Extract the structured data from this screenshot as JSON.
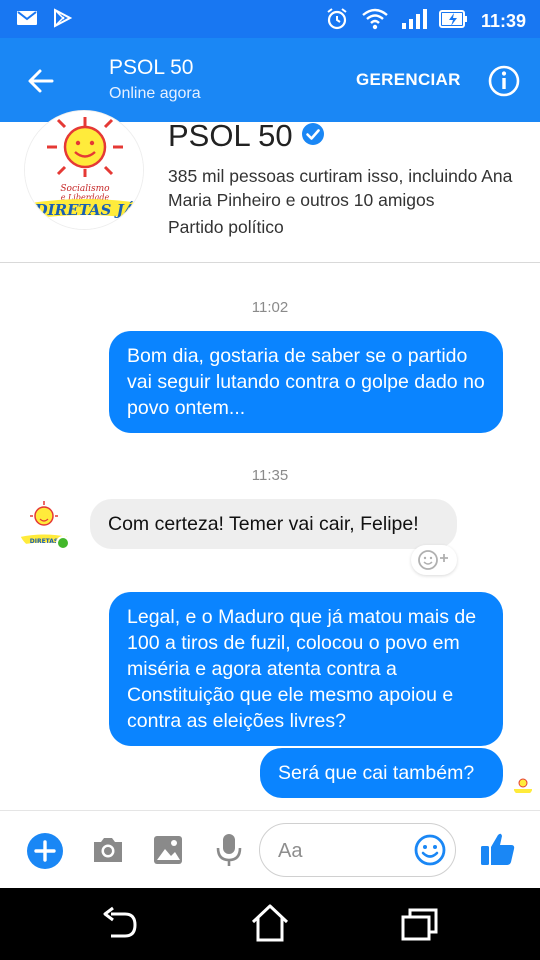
{
  "status_bar": {
    "time": "11:39",
    "icons": [
      "mail-icon",
      "play-store-icon",
      "alarm-icon",
      "wifi-icon",
      "signal-icon",
      "battery-charging-icon"
    ]
  },
  "app_bar": {
    "title": "PSOL 50",
    "subtitle": "Online agora",
    "manage_label": "GERENCIAR",
    "icons": [
      "back-arrow-icon",
      "info-icon"
    ]
  },
  "page_header": {
    "name": "PSOL 50",
    "likes_text": "385 mil pessoas curtiram isso, incluindo Ana Maria Pinheiro e outros 10 amigos",
    "category": "Partido político",
    "verified_icon": "verified-badge-icon",
    "avatar_text": "SOCIALISMO E LIBERDADE · DIRETAS JÁ"
  },
  "chat": {
    "messages": [
      {
        "type": "timestamp",
        "text": "11:02"
      },
      {
        "type": "outgoing",
        "text": "Bom dia, gostaria de saber se o partido vai seguir lutando contra o golpe dado no povo ontem..."
      },
      {
        "type": "timestamp",
        "text": "11:35"
      },
      {
        "type": "incoming",
        "text": "Com certeza! Temer vai cair, Felipe!"
      },
      {
        "type": "outgoing",
        "text": "Legal, e o Maduro que já matou mais de 100 a tiros de fuzil, colocou o povo em miséria e agora atenta contra a Constituição que ele mesmo apoiou e contra as eleições livres?"
      },
      {
        "type": "outgoing",
        "text": "Será que cai também?"
      }
    ]
  },
  "composer": {
    "placeholder": "Aa",
    "icons": [
      "plus-icon",
      "camera-icon",
      "gallery-icon",
      "microphone-icon",
      "emoji-icon",
      "thumbs-up-icon"
    ]
  },
  "nav_bar": {
    "icons": [
      "back-nav-icon",
      "home-nav-icon",
      "recents-nav-icon"
    ]
  },
  "colors": {
    "brand_blue": "#1a87f5",
    "outgoing_bubble": "#0a84ff",
    "incoming_bubble": "#eeeeee",
    "online_green": "#42b72a"
  }
}
